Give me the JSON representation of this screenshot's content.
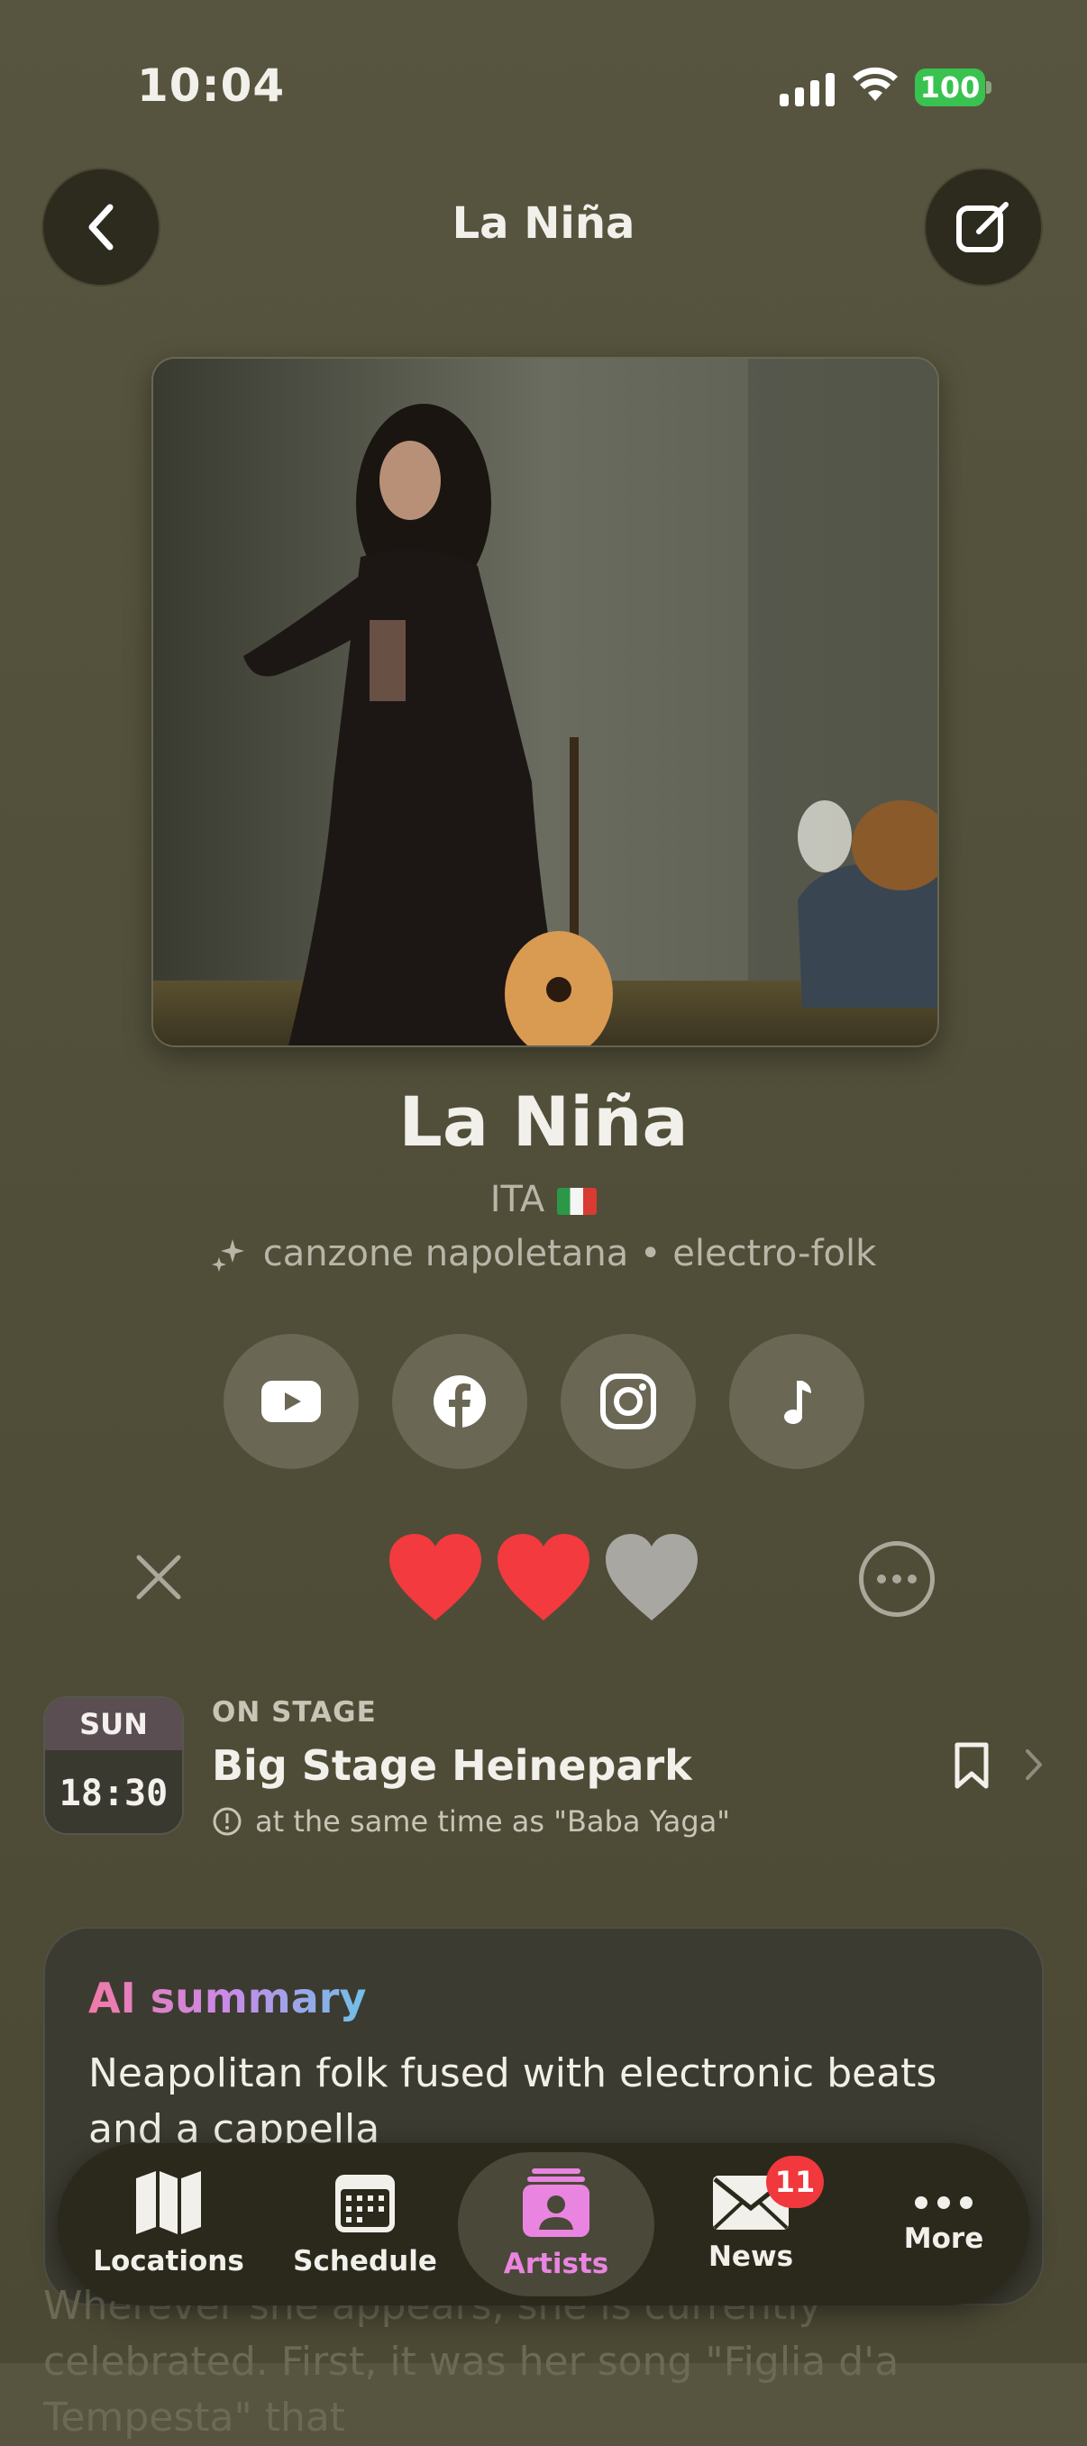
{
  "status": {
    "time": "10:04",
    "battery": "100"
  },
  "header": {
    "title": "La Niña"
  },
  "artist": {
    "name": "La Niña",
    "country": "ITA",
    "genres": "canzone napoletana • electro-folk"
  },
  "socials": [
    "youtube-icon",
    "facebook-icon",
    "instagram-icon",
    "music-note-icon"
  ],
  "rating": {
    "filled_hearts": 2,
    "total_hearts": 3
  },
  "schedule": {
    "day": "SUN",
    "time": "18:30",
    "label": "ON STAGE",
    "stage": "Big Stage Heinepark",
    "conflict": "at the same time as \"Baba Yaga\""
  },
  "summary": {
    "title": "AI summary",
    "text": "Neapolitan folk fused with electronic beats and a cappella"
  },
  "bio": "Wherever she appears, she is currently celebrated. First, it was her song \"Figlia d'a Tempesta\" that",
  "tabs": [
    {
      "label": "Locations",
      "icon": "map-icon"
    },
    {
      "label": "Schedule",
      "icon": "calendar-icon"
    },
    {
      "label": "Artists",
      "icon": "artist-icon"
    },
    {
      "label": "News",
      "icon": "envelope-icon"
    },
    {
      "label": "More",
      "icon": "more-icon"
    }
  ],
  "news_badge": "11",
  "colors": {
    "heart": "#f23a3f",
    "heart_empty": "#a9a7a2",
    "active_tab": "#e985e0",
    "background": "#555340"
  }
}
